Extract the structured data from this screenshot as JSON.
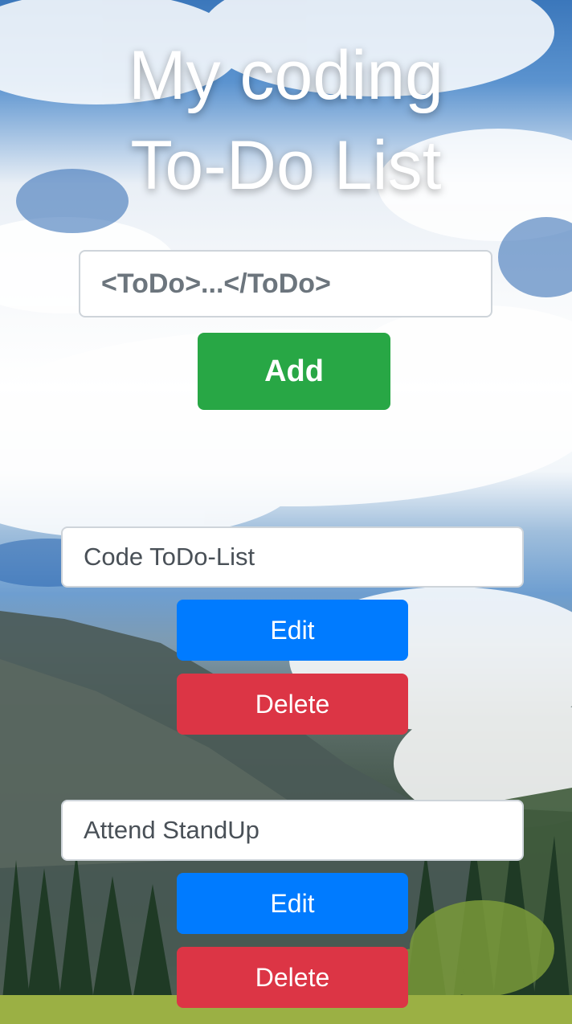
{
  "app": {
    "title_line1": "My coding",
    "title_line2": "To-Do List"
  },
  "new_todo": {
    "placeholder": "<ToDo>...</ToDo>",
    "value": "",
    "add_label": "Add"
  },
  "todos": [
    {
      "text": "Code ToDo-List",
      "edit_label": "Edit",
      "delete_label": "Delete"
    },
    {
      "text": "Attend StandUp",
      "edit_label": "Edit",
      "delete_label": "Delete"
    }
  ],
  "colors": {
    "add_button": "#28a745",
    "edit_button": "#007bff",
    "delete_button": "#dc3545",
    "title_text": "#ffffff"
  },
  "background": {
    "scene": "sky-clouds-mountain-forest-photo"
  }
}
